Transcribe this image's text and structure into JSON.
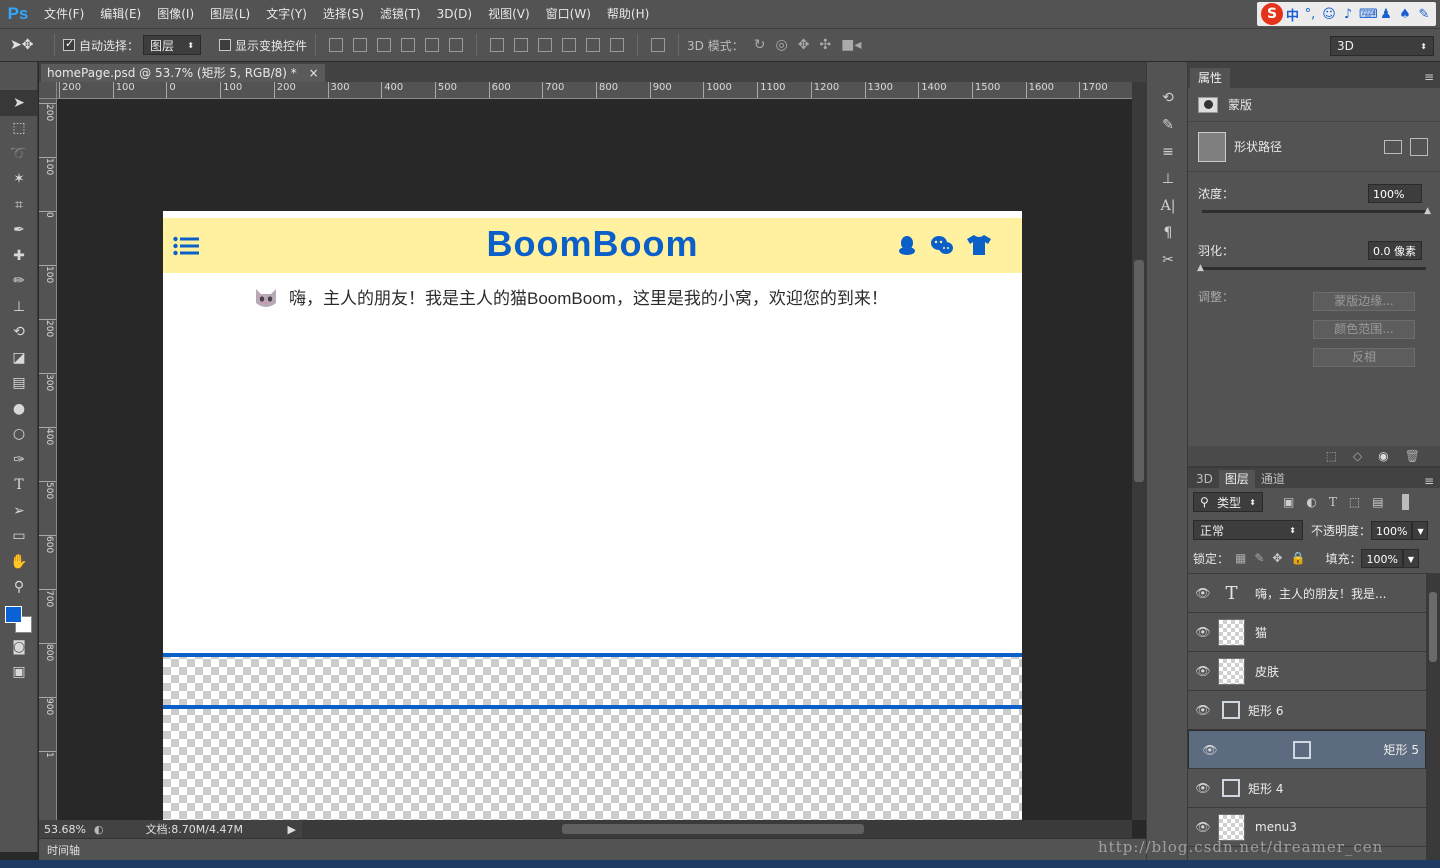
{
  "app": {
    "logo": "Ps",
    "menu": [
      "文件(F)",
      "编辑(E)",
      "图像(I)",
      "图层(L)",
      "文字(Y)",
      "选择(S)",
      "滤镜(T)",
      "3D(D)",
      "视图(V)",
      "窗口(W)",
      "帮助(H)"
    ],
    "ime": {
      "brand": "S",
      "lang": "中"
    }
  },
  "options": {
    "auto_select_label": "自动选择：",
    "auto_select_value": "图层",
    "transform_label": "显示变换控件",
    "mode_3d_label": "3D 模式：",
    "workspace_value": "3D"
  },
  "document": {
    "tab_title": "homePage.psd @ 53.7% (矩形 5, RGB/8) *",
    "ruler_top": [
      "200",
      "100",
      "0",
      "100",
      "200",
      "300",
      "400",
      "500",
      "600",
      "700",
      "800",
      "900",
      "1000",
      "1100",
      "1200",
      "1300",
      "1400",
      "1500",
      "1600",
      "1700"
    ],
    "ruler_left": [
      "200",
      "100",
      "0",
      "100",
      "200",
      "300",
      "400",
      "500",
      "600",
      "700",
      "800",
      "900",
      "1"
    ],
    "zoom": "53.68%",
    "doc_size": "文档:8.70M/4.47M",
    "timeline_label": "时间轴"
  },
  "website": {
    "brand": "BoomBoom",
    "greeting": "嗨，主人的朋友！我是主人的猫BoomBoom，这里是我的小窝，欢迎您的到来！",
    "brand_color": "#0b5fc9",
    "header_color": "#fff19f"
  },
  "properties": {
    "tab": "属性",
    "mask_label": "蒙版",
    "shape_path_label": "形状路径",
    "density_label": "浓度：",
    "density_value": "100%",
    "feather_label": "羽化：",
    "feather_value": "0.0 像素",
    "adjust_label": "调整：",
    "buttons": [
      "蒙版边缘...",
      "颜色范围...",
      "反相"
    ]
  },
  "layers": {
    "tabs": [
      "3D",
      "图层",
      "通道"
    ],
    "filter_label": "类型",
    "blend_mode": "正常",
    "opacity_label": "不透明度：",
    "opacity_value": "100%",
    "lock_label": "锁定：",
    "fill_label": "填充：",
    "fill_value": "100%",
    "items": [
      {
        "name": "嗨，主人的朋友！我是...",
        "kind": "text"
      },
      {
        "name": "猫",
        "kind": "smart"
      },
      {
        "name": "皮肤",
        "kind": "smart"
      },
      {
        "name": "矩形 6",
        "kind": "shape"
      },
      {
        "name": "矩形 5",
        "kind": "shape",
        "selected": true
      },
      {
        "name": "矩形 4",
        "kind": "shape"
      },
      {
        "name": "menu3",
        "kind": "smart"
      }
    ]
  },
  "watermark": "http://blog.csdn.net/dreamer_cen"
}
